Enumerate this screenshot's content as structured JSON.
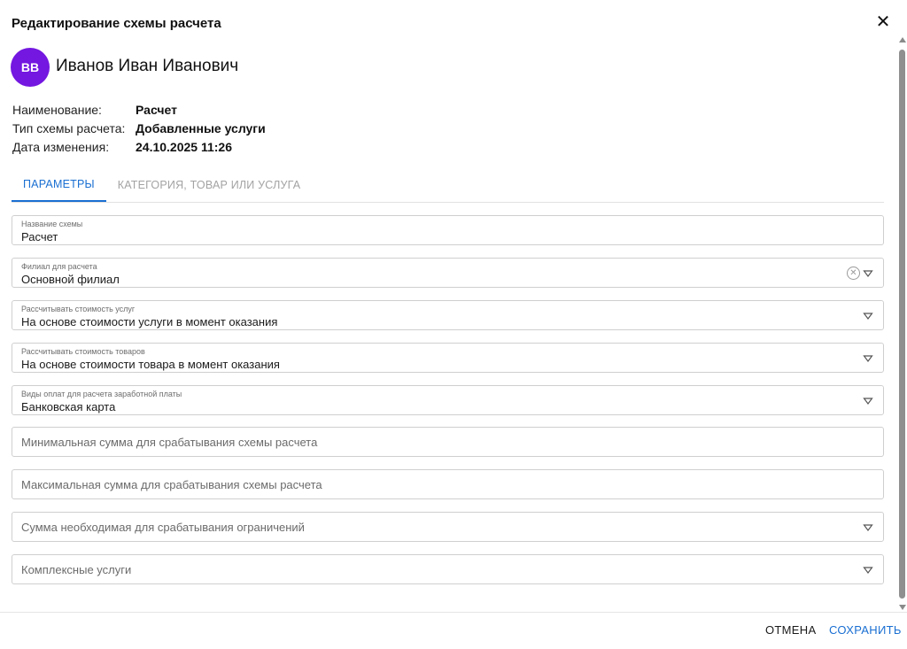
{
  "dialog": {
    "title": "Редактирование схемы расчета",
    "close_icon": "close-icon"
  },
  "user": {
    "initials": "ВВ",
    "name": "Иванов Иван Иванович",
    "avatar_color": "#7417e0"
  },
  "info": [
    {
      "label": "Наименование:",
      "value": "Расчет"
    },
    {
      "label": "Тип схемы расчета:",
      "value": "Добавленные услуги"
    },
    {
      "label": "Дата изменения:",
      "value": "24.10.2025 11:26"
    }
  ],
  "tabs": [
    {
      "label": "ПАРАМЕТРЫ",
      "active": true
    },
    {
      "label": "КАТЕГОРИЯ, ТОВАР ИЛИ УСЛУГА",
      "active": false
    }
  ],
  "fields": {
    "scheme_name": {
      "label": "Название схемы",
      "value": "Расчет"
    },
    "branch": {
      "label": "Филиал для расчета",
      "value": "Основной филиал"
    },
    "service_cost": {
      "label": "Рассчитывать стоимость услуг",
      "value": "На основе стоимости услуги в момент оказания"
    },
    "goods_cost": {
      "label": "Рассчитывать стоимость товаров",
      "value": "На основе стоимости товара в момент оказания"
    },
    "payment_types": {
      "label": "Виды оплат для расчета заработной платы",
      "value": "Банковская карта"
    },
    "min_sum": {
      "placeholder": "Минимальная сумма для срабатывания схемы расчета"
    },
    "max_sum": {
      "placeholder": "Максимальная сумма для срабатывания схемы расчета"
    },
    "limit_sum": {
      "placeholder": "Сумма необходимая для срабатывания ограничений"
    },
    "complex_services": {
      "placeholder": "Комплексные услуги"
    }
  },
  "footer": {
    "cancel_label": "ОТМЕНА",
    "save_label": "СОХРАНИТЬ"
  },
  "colors": {
    "accent": "#1a6fd2",
    "avatar": "#7417e0"
  }
}
